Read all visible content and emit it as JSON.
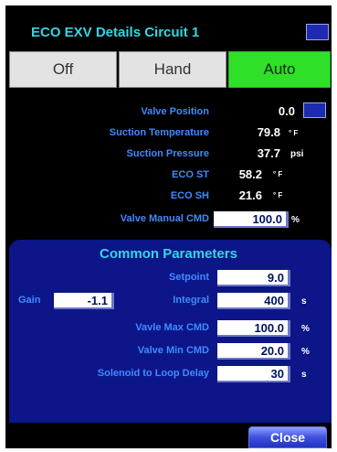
{
  "header": {
    "title": "ECO EXV Details Circuit 1"
  },
  "modes": [
    {
      "label": "Off",
      "active": false
    },
    {
      "label": "Hand",
      "active": false
    },
    {
      "label": "Auto",
      "active": true
    }
  ],
  "status": [
    {
      "label": "Valve Position",
      "value": "0.0",
      "unit": ""
    },
    {
      "label": "Suction Temperature",
      "value": "79.8",
      "unit": "° F"
    },
    {
      "label": "Suction Pressure",
      "value": "37.7",
      "unit": "psi"
    },
    {
      "label": "ECO ST",
      "value": "58.2",
      "unit": "° F"
    },
    {
      "label": "ECO SH",
      "value": "21.6",
      "unit": "° F"
    }
  ],
  "manual_cmd": {
    "label": "Valve Manual CMD",
    "value": "100.0",
    "unit": "%"
  },
  "common": {
    "title": "Common Parameters",
    "gain": {
      "label": "Gain",
      "value": "-1.1"
    },
    "setpoint": {
      "label": "Setpoint",
      "value": "9.0",
      "unit": ""
    },
    "integral": {
      "label": "Integral",
      "value": "400",
      "unit": "s"
    },
    "max_cmd": {
      "label": "Vavle Max CMD",
      "value": "100.0",
      "unit": "%"
    },
    "min_cmd": {
      "label": "Valve Min CMD",
      "value": "20.0",
      "unit": "%"
    },
    "delay": {
      "label": "Solenoid to Loop Delay",
      "value": "30",
      "unit": "s"
    }
  },
  "footer": {
    "close_label": "Close"
  },
  "colors": {
    "background": "#000000",
    "label": "#3f8bff",
    "title": "#33d6e6",
    "panel": "#0c1688",
    "active": "#2ee027"
  }
}
